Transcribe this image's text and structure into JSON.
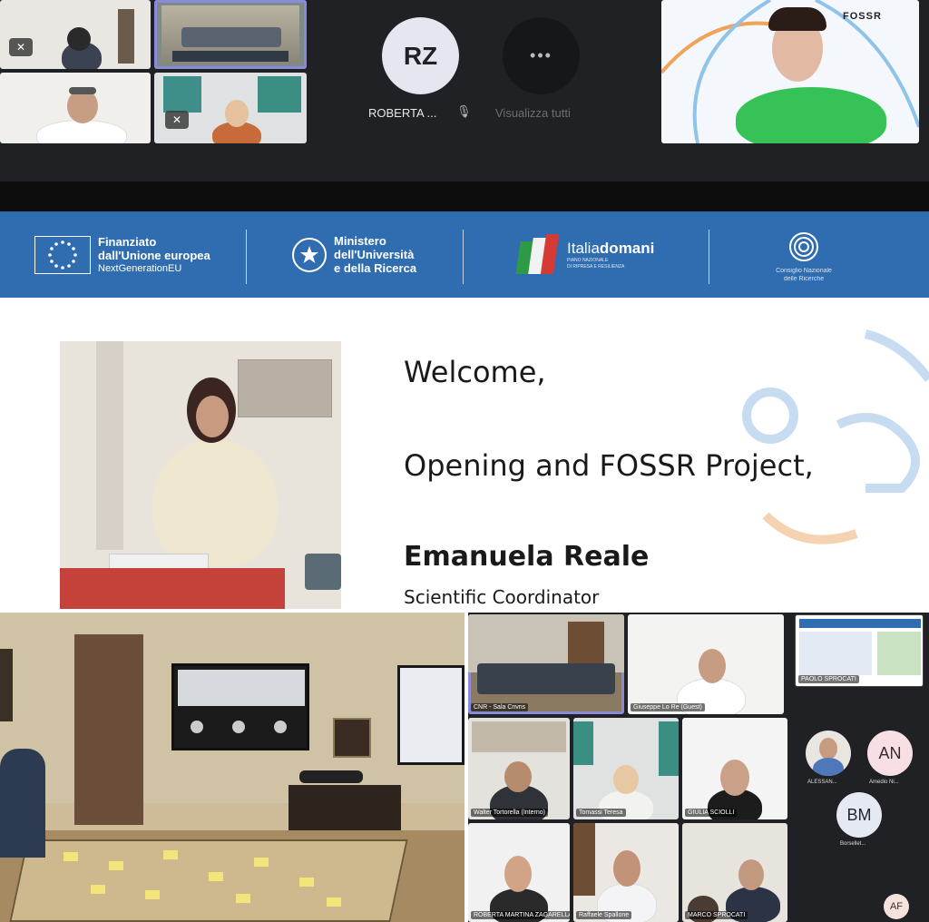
{
  "meeting": {
    "avatar_rz": {
      "initials": "RZ",
      "name": "ROBERTA ..."
    },
    "more_tile": {
      "icon": "ellipsis-icon",
      "symbol": "•••",
      "label": "Visualizza tutti"
    },
    "speaker_logo": "FOSSR"
  },
  "slide": {
    "banner": {
      "eu": {
        "line1": "Finanziato",
        "line2": "dall'Unione europea",
        "line3": "NextGenerationEU"
      },
      "ministry": {
        "line1": "Ministero",
        "line2": "dell'Università",
        "line3": "e della Ricerca"
      },
      "italia": {
        "brand_light": "Italia",
        "brand_bold": "domani",
        "sub1": "PIANO NAZIONALE",
        "sub2": "DI RIPRESA E RESILIENZA"
      },
      "cnr": {
        "line1": "Consiglio Nazionale",
        "line2": "delle Ricerche"
      }
    },
    "welcome": "Welcome,",
    "subtitle": "Opening and FOSSR Project,",
    "speaker_name": "Emanuela Reale",
    "speaker_role": "Scientific Coordinator"
  },
  "bottom_grid": {
    "tiles": [
      {
        "name": "CNR - Sala Cnvns"
      },
      {
        "name": "Giuseppe Lo Re (Guest)"
      },
      {
        "name": "PAOLO SPROCATI"
      },
      {
        "name": "Walter Tortorella (Interno)"
      },
      {
        "name": "Tomassi Teresa"
      },
      {
        "name": "GIULIA SCIOLLI"
      },
      {
        "name": "ROBERTA MARTINA ZAGARELLA"
      },
      {
        "name": "Raffaele Spallone"
      },
      {
        "name": "MARCO SPROCATI"
      }
    ],
    "side_participants": [
      {
        "label": "ALESSAN..."
      },
      {
        "initials": "AN",
        "label": "Amedio Ni..."
      },
      {
        "initials": "BM",
        "label": "Borsellet..."
      }
    ],
    "self_avatar": "AF"
  },
  "colors": {
    "banner_blue": "#2f6db0",
    "meet_dark": "#202124",
    "active_outline": "#8a8ad8"
  }
}
